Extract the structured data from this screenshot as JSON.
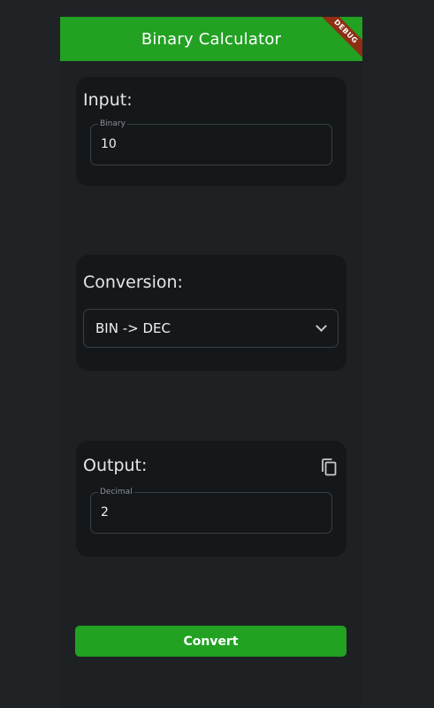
{
  "appbar": {
    "title": "Binary Calculator",
    "debug_label": "DEBUG",
    "color": "#22a122"
  },
  "input_card": {
    "title": "Input:",
    "field_label": "Binary",
    "field_value": "10"
  },
  "conversion_card": {
    "title": "Conversion:",
    "selected": "BIN -> DEC",
    "dropdown_icon": "chevron-down-icon"
  },
  "output_card": {
    "title": "Output:",
    "copy_icon": "copy-icon",
    "field_label": "Decimal",
    "field_value": "2"
  },
  "actions": {
    "convert_label": "Convert",
    "color": "#22a122"
  }
}
